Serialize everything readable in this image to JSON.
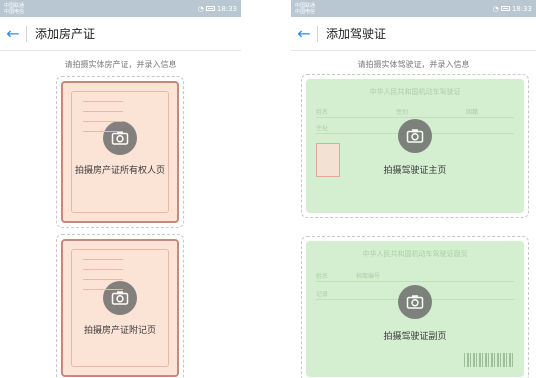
{
  "left_screen": {
    "status": {
      "carrier1": "中国联通",
      "carrier2": "中国电信",
      "time": "18:33"
    },
    "appbar": {
      "back_glyph": "←",
      "title": "添加房产证"
    },
    "hint": "请拍摄实体房产证，并录入信息",
    "cards": [
      {
        "label": "拍摄房产证所有权人页",
        "icon": "camera-icon"
      },
      {
        "label": "拍摄房产证附记页",
        "icon": "camera-icon"
      }
    ]
  },
  "right_screen": {
    "status": {
      "carrier1": "中国联通",
      "carrier2": "中国电信",
      "time": "18:33"
    },
    "appbar": {
      "back_glyph": "←",
      "title": "添加驾驶证"
    },
    "hint": "请拍摄实体驾驶证，并录入信息",
    "cards": [
      {
        "label": "拍摄驾驶证主页",
        "icon": "camera-icon",
        "bg_title": "中华人民共和国机动车驾驶证",
        "bg_fields": [
          "姓名",
          "性别",
          "国籍",
          "住址"
        ]
      },
      {
        "label": "拍摄驾驶证副页",
        "icon": "camera-icon",
        "bg_title": "中华人民共和国机动车驾驶证副页",
        "bg_fields": [
          "姓名",
          "档案编号",
          "记录"
        ]
      }
    ]
  },
  "colors": {
    "accent": "#2a8df0",
    "deed_bg": "#fbe3d6",
    "license_bg": "#d4efd0",
    "camera_circle": "#6e6e6e"
  }
}
